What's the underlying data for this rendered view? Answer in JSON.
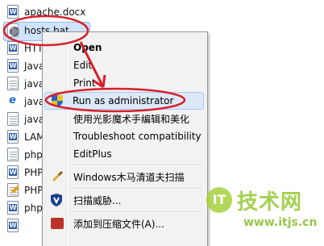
{
  "files": [
    {
      "name": "apache.docx",
      "icon": "word-doc-icon"
    },
    {
      "name": "hosts.bat",
      "icon": "batch-file-icon",
      "selected": true
    },
    {
      "name": "HTT",
      "icon": "word-doc-icon"
    },
    {
      "name": "JavaS",
      "icon": "word-doc-icon"
    },
    {
      "name": "javas",
      "icon": "text-file-icon"
    },
    {
      "name": "javas",
      "icon": "html-file-icon"
    },
    {
      "name": "javas",
      "icon": "text-file-icon"
    },
    {
      "name": "LAM",
      "icon": "word-doc-icon"
    },
    {
      "name": "php",
      "icon": "text-file-icon"
    },
    {
      "name": "PHP",
      "icon": "word-doc-icon"
    },
    {
      "name": "PHP",
      "icon": "edit-file-icon"
    },
    {
      "name": "phpl",
      "icon": "word-doc-icon"
    },
    {
      "name": "",
      "icon": "word-doc-icon"
    }
  ],
  "menu": {
    "items": [
      {
        "label": "Open",
        "bold": true,
        "icon": null
      },
      {
        "label": "Edit",
        "icon": null
      },
      {
        "label": "Print",
        "icon": null
      },
      {
        "label": "Run as administrator",
        "icon": "uac-shield-icon",
        "highlighted": true
      },
      {
        "label": "使用光影魔术手编辑和美化",
        "icon": null
      },
      {
        "label": "Troubleshoot compatibility",
        "icon": null
      },
      {
        "label": "EditPlus",
        "icon": null
      },
      {
        "label": "Windows木马清道夫扫描",
        "icon": "broom-icon"
      },
      {
        "label": "扫描威胁...",
        "icon": "scan-shield-icon"
      },
      {
        "label": "添加到压缩文件(A)...",
        "icon": "archive-icon"
      }
    ]
  },
  "watermark": {
    "logo_text": "IT",
    "title": "技术网",
    "url": "www.itjs.cn"
  },
  "colors": {
    "annotation": "#d6202b",
    "highlight": "#dce9f9",
    "watermark": "#9ccc3c"
  }
}
